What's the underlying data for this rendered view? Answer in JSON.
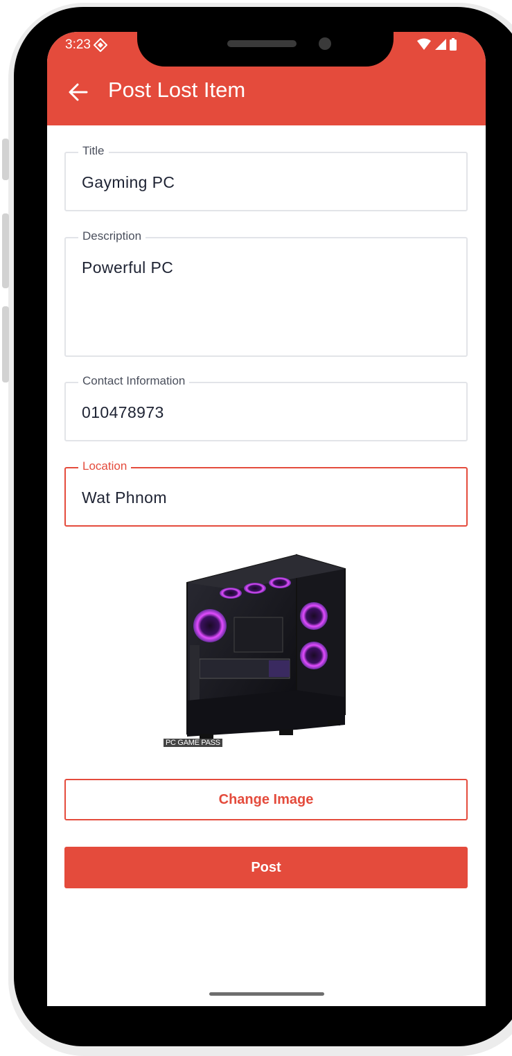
{
  "status_bar": {
    "time": "3:23"
  },
  "app_bar": {
    "title": "Post Lost Item",
    "back_icon": "arrow-left-icon"
  },
  "form": {
    "title": {
      "label": "Title",
      "value": "Gayming PC"
    },
    "description": {
      "label": "Description",
      "value": "Powerful PC"
    },
    "contact": {
      "label": "Contact Information",
      "value": "010478973"
    },
    "location": {
      "label": "Location",
      "value": "Wat Phnom"
    }
  },
  "image": {
    "watermark": "PC GAME PASS"
  },
  "buttons": {
    "change_image": "Change Image",
    "post": "Post"
  },
  "colors": {
    "accent": "#e44b3c",
    "border": "#e2e4e8",
    "text": "#1e2333"
  }
}
